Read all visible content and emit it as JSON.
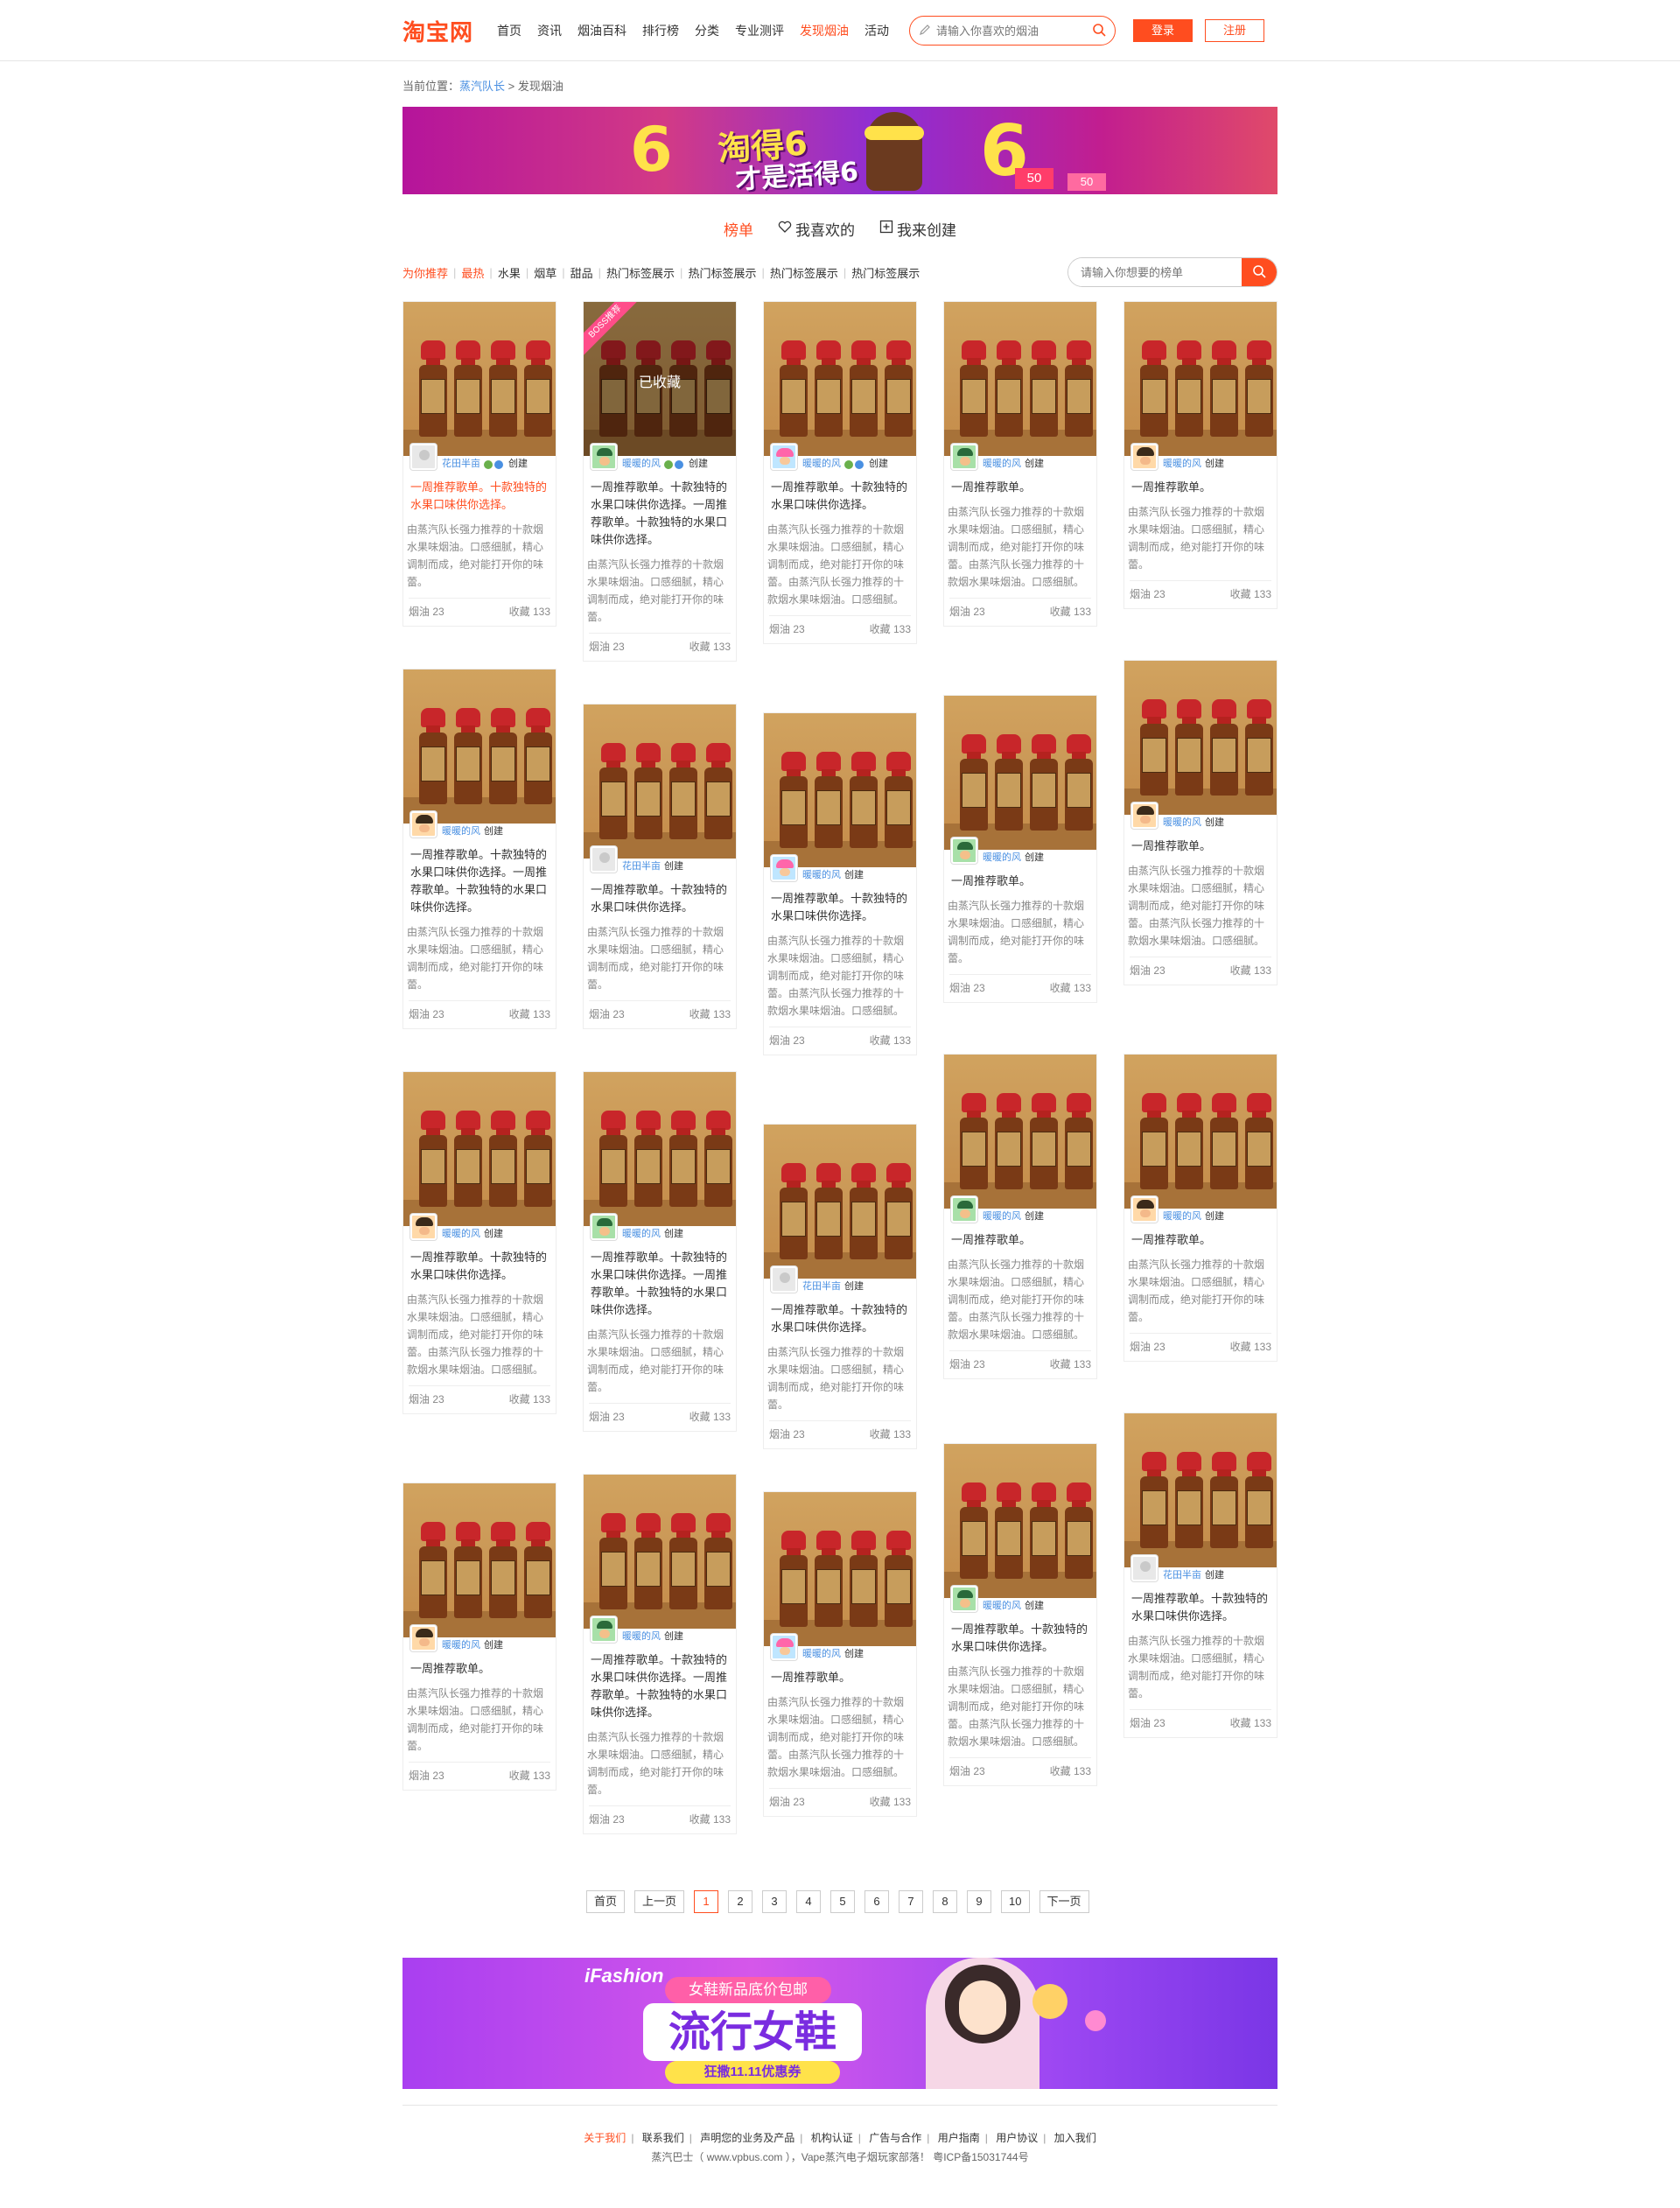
{
  "header": {
    "logo": "淘宝网",
    "nav": [
      "首页",
      "资讯",
      "烟油百科",
      "排行榜",
      "分类",
      "专业测评",
      "发现烟油",
      "活动"
    ],
    "active_nav": "发现烟油",
    "search_placeholder": "请输入你喜欢的烟油",
    "login": "登录",
    "register": "注册"
  },
  "breadcrumb": {
    "prefix": "当前位置：",
    "parent": "蒸汽队长",
    "arrow": ">",
    "current": "发现烟油"
  },
  "top_banner": {
    "line1": "淘得6",
    "line2": "才是活得6",
    "tag1": "50",
    "tag2": "50"
  },
  "tabs": [
    "榜单",
    "我喜欢的",
    "我来创建"
  ],
  "filters": {
    "cats": [
      "为你推荐",
      "最热",
      "水果",
      "烟草",
      "甜品",
      "热门标签展示",
      "热门标签展示",
      "热门标签展示",
      "热门标签展示"
    ],
    "search_placeholder": "请输入你想要的榜单"
  },
  "card_labels": {
    "made": "创建",
    "saved": "已收藏",
    "ribbon": "BOSS推荐",
    "oil": "烟油 23",
    "fav": "收藏 133"
  },
  "cards": [
    {
      "user": "花田半亩",
      "title": "一周推荐歌单。十款独特的水果口味供你选择。",
      "desc": "由蒸汽队长强力推荐的十款烟水果味烟油。口感细腻，精心调制而成，绝对能打开你的味蕾。"
    },
    {
      "user": "暖暖的风",
      "title": "一周推荐歌单。十款独特的水果口味供你选择。一周推荐歌单。十款独特的水果口味供你选择。",
      "desc": "由蒸汽队长强力推荐的十款烟水果味烟油。口感细腻，精心调制而成，绝对能打开你的味蕾。"
    },
    {
      "user": "暖暖的风",
      "title": "一周推荐歌单。十款独特的水果口味供你选择。",
      "desc": "由蒸汽队长强力推荐的十款烟水果味烟油。口感细腻，精心调制而成，绝对能打开你的味蕾。由蒸汽队长强力推荐的十款烟水果味烟油。口感细腻。"
    },
    {
      "user": "暖暖的风",
      "title": "一周推荐歌单。",
      "desc": "由蒸汽队长强力推荐的十款烟水果味烟油。口感细腻，精心调制而成，绝对能打开你的味蕾。由蒸汽队长强力推荐的十款烟水果味烟油。口感细腻。"
    },
    {
      "user": "暖暖的风",
      "title": "一周推荐歌单。",
      "desc": "由蒸汽队长强力推荐的十款烟水果味烟油。口感细腻，精心调制而成，绝对能打开你的味蕾。"
    },
    {
      "user": "暖暖的风",
      "title": "一周推荐歌单。十款独特的水果口味供你选择。一周推荐歌单。十款独特的水果口味供你选择。",
      "desc": "由蒸汽队长强力推荐的十款烟水果味烟油。口感细腻，精心调制而成，绝对能打开你的味蕾。"
    },
    {
      "user": "花田半亩",
      "title": "一周推荐歌单。十款独特的水果口味供你选择。",
      "desc": "由蒸汽队长强力推荐的十款烟水果味烟油。口感细腻，精心调制而成，绝对能打开你的味蕾。"
    },
    {
      "user": "暖暖的风",
      "title": "一周推荐歌单。十款独特的水果口味供你选择。",
      "desc": "由蒸汽队长强力推荐的十款烟水果味烟油。口感细腻，精心调制而成，绝对能打开你的味蕾。由蒸汽队长强力推荐的十款烟水果味烟油。口感细腻。"
    },
    {
      "user": "暖暖的风",
      "title": "一周推荐歌单。",
      "desc": "由蒸汽队长强力推荐的十款烟水果味烟油。口感细腻，精心调制而成，绝对能打开你的味蕾。"
    },
    {
      "user": "暖暖的风",
      "title": "一周推荐歌单。",
      "desc": "由蒸汽队长强力推荐的十款烟水果味烟油。口感细腻，精心调制而成，绝对能打开你的味蕾。由蒸汽队长强力推荐的十款烟水果味烟油。口感细腻。"
    },
    {
      "user": "暖暖的风",
      "title": "一周推荐歌单。十款独特的水果口味供你选择。",
      "desc": "由蒸汽队长强力推荐的十款烟水果味烟油。口感细腻，精心调制而成，绝对能打开你的味蕾。由蒸汽队长强力推荐的十款烟水果味烟油。口感细腻。"
    },
    {
      "user": "暖暖的风",
      "title": "一周推荐歌单。十款独特的水果口味供你选择。一周推荐歌单。十款独特的水果口味供你选择。",
      "desc": "由蒸汽队长强力推荐的十款烟水果味烟油。口感细腻，精心调制而成，绝对能打开你的味蕾。"
    },
    {
      "user": "花田半亩",
      "title": "一周推荐歌单。十款独特的水果口味供你选择。",
      "desc": "由蒸汽队长强力推荐的十款烟水果味烟油。口感细腻，精心调制而成，绝对能打开你的味蕾。"
    },
    {
      "user": "暖暖的风",
      "title": "一周推荐歌单。",
      "desc": "由蒸汽队长强力推荐的十款烟水果味烟油。口感细腻，精心调制而成，绝对能打开你的味蕾。由蒸汽队长强力推荐的十款烟水果味烟油。口感细腻。"
    },
    {
      "user": "暖暖的风",
      "title": "一周推荐歌单。",
      "desc": "由蒸汽队长强力推荐的十款烟水果味烟油。口感细腻，精心调制而成，绝对能打开你的味蕾。"
    },
    {
      "user": "暖暖的风",
      "title": "一周推荐歌单。",
      "desc": "由蒸汽队长强力推荐的十款烟水果味烟油。口感细腻，精心调制而成，绝对能打开你的味蕾。"
    },
    {
      "user": "暖暖的风",
      "title": "一周推荐歌单。十款独特的水果口味供你选择。一周推荐歌单。十款独特的水果口味供你选择。",
      "desc": "由蒸汽队长强力推荐的十款烟水果味烟油。口感细腻，精心调制而成，绝对能打开你的味蕾。"
    },
    {
      "user": "暖暖的风",
      "title": "一周推荐歌单。",
      "desc": "由蒸汽队长强力推荐的十款烟水果味烟油。口感细腻，精心调制而成，绝对能打开你的味蕾。由蒸汽队长强力推荐的十款烟水果味烟油。口感细腻。"
    },
    {
      "user": "暖暖的风",
      "title": "一周推荐歌单。十款独特的水果口味供你选择。",
      "desc": "由蒸汽队长强力推荐的十款烟水果味烟油。口感细腻，精心调制而成，绝对能打开你的味蕾。由蒸汽队长强力推荐的十款烟水果味烟油。口感细腻。"
    },
    {
      "user": "花田半亩",
      "title": "一周推荐歌单。十款独特的水果口味供你选择。",
      "desc": "由蒸汽队长强力推荐的十款烟水果味烟油。口感细腻，精心调制而成，绝对能打开你的味蕾。"
    }
  ],
  "pagination": [
    "首页",
    "上一页",
    "1",
    "2",
    "3",
    "4",
    "5",
    "6",
    "7",
    "8",
    "9",
    "10",
    "下一页"
  ],
  "current_page": "1",
  "bottom_banner": {
    "brand": "iFashion",
    "strip": "女鞋新品底价包邮",
    "big": "流行女鞋",
    "promo": "狂撒11.11优惠券"
  },
  "footer": {
    "links": [
      "关于我们",
      "联系我们",
      "声明您的业务及产品",
      "机构认证",
      "广告与合作",
      "用户指南",
      "用户协议",
      "加入我们"
    ],
    "copyright": "蒸汽巴士（ www.vpbus.com ），Vape蒸汽电子烟玩家部落！ 粤ICP备15031744号"
  }
}
